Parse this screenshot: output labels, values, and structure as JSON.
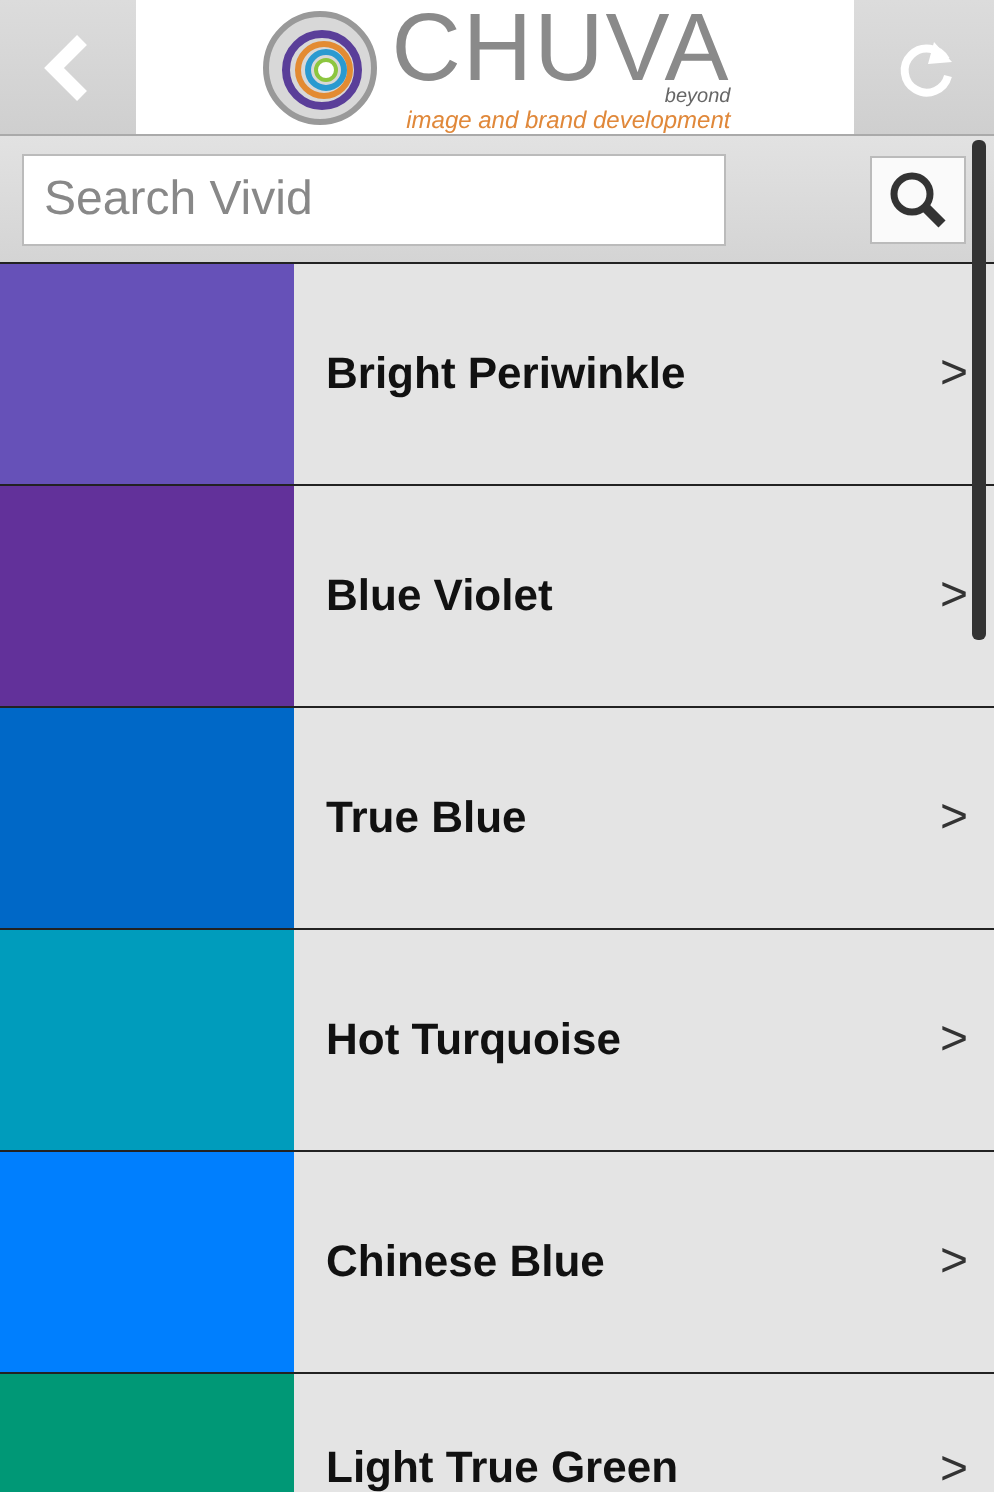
{
  "header": {
    "logo_name": "CHUVA",
    "logo_sub": "beyond",
    "tagline": "image and brand development"
  },
  "search": {
    "placeholder": "Search Vivid"
  },
  "colors": [
    {
      "name": "Bright Periwinkle",
      "color": "#6651b8",
      "chevron": ">"
    },
    {
      "name": "Blue Violet",
      "color": "#62319a",
      "chevron": ">"
    },
    {
      "name": "True Blue",
      "color": "#0068c7",
      "chevron": ">"
    },
    {
      "name": "Hot Turquoise",
      "color": "#009cbc",
      "chevron": ">"
    },
    {
      "name": "Chinese Blue",
      "color": "#007ffe",
      "chevron": ">"
    },
    {
      "name": "Light True Green",
      "color": "#009876",
      "chevron": ">"
    }
  ]
}
